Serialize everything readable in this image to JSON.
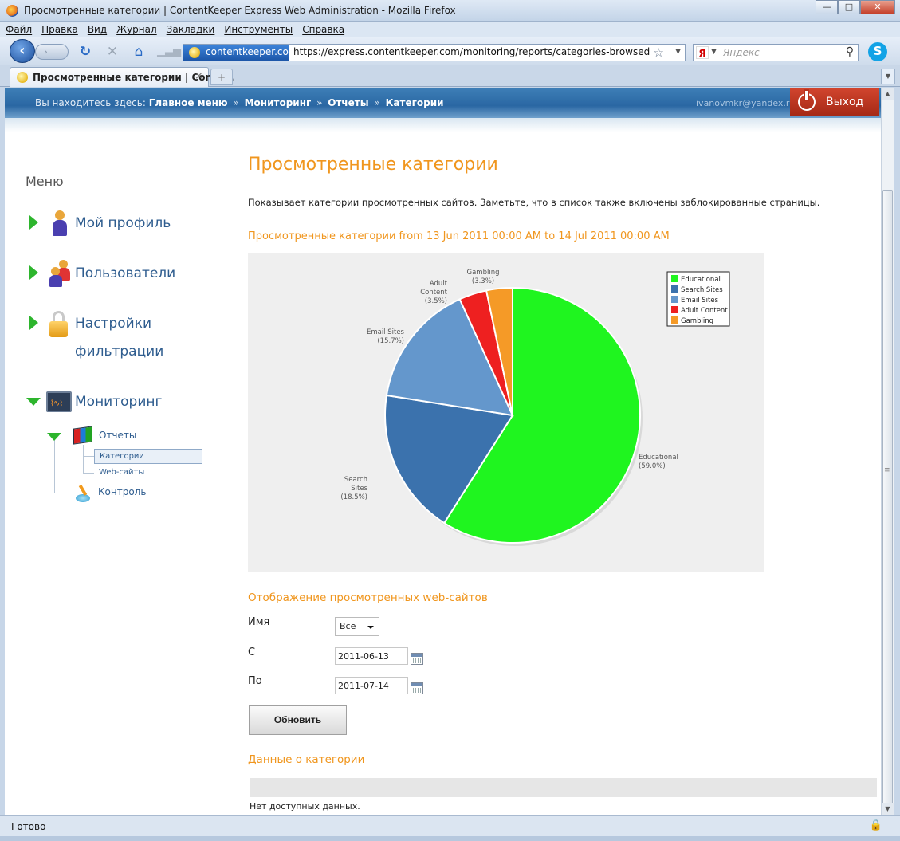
{
  "window": {
    "title": "Просмотренные категории | ContentKeeper Express Web Administration - Mozilla Firefox",
    "controls": [
      "—",
      "□",
      "✕"
    ]
  },
  "menubar": [
    "Файл",
    "Правка",
    "Вид",
    "Журнал",
    "Закладки",
    "Инструменты",
    "Справка"
  ],
  "navbar": {
    "site_identity": "contentkeeper.com",
    "url": "https://express.contentkeeper.com/monitoring/reports/categories-browsed",
    "search_placeholder": "Яндекс",
    "search_engine_badge": "Я"
  },
  "tab": {
    "title": "Просмотренные категории | Conte...",
    "close": "×",
    "new": "+"
  },
  "header": {
    "breadcrumb_prefix": "Вы находитесь здесь:",
    "breadcrumbs": [
      "Главное меню",
      "Мониторинг",
      "Отчеты",
      "Категории"
    ],
    "breadcrumb_sep": "»",
    "user_email": "ivanovmkr@yandex.ru",
    "logout": "Выход"
  },
  "sidebar": {
    "menu_title": "Меню",
    "items": [
      {
        "label": "Мой профиль"
      },
      {
        "label": "Пользователи"
      },
      {
        "label": "Настройки",
        "label2": "фильтрации"
      },
      {
        "label": "Мониторинг"
      }
    ],
    "reports": "Отчеты",
    "categories": "Категории",
    "websites": "Web-сайты",
    "control": "Контроль"
  },
  "main": {
    "title": "Просмотренные категории",
    "description": "Показывает категории просмотренных сайтов. Заметьте, что в список также включены заблокированные страницы.",
    "chart_heading": "Просмотренные категории from 13 Jun 2011 00:00 AM to 14 Jul 2011 00:00 AM",
    "display_heading": "Отображение просмотренных web-сайтов",
    "name_label": "Имя",
    "name_value": "Все",
    "from_label": "С",
    "from_value": "2011-06-13",
    "to_label": "По",
    "to_value": "2011-07-14",
    "update_button": "Обновить",
    "data_heading": "Данные о категории",
    "no_data": "Нет доступных данных."
  },
  "status": {
    "text": "Готово"
  },
  "chart_data": {
    "type": "pie",
    "categories": [
      "Educational",
      "Search Sites",
      "Email Sites",
      "Adult Content",
      "Gambling"
    ],
    "values": [
      59.0,
      18.5,
      15.7,
      3.5,
      3.3
    ],
    "value_labels": [
      "(59.0%)",
      "(18.5%)",
      "(15.7%)",
      "(3.5%)",
      "(3.3%)"
    ],
    "slice_labels": [
      [
        "Educational"
      ],
      [
        "Search",
        "Sites"
      ],
      [
        "Email Sites"
      ],
      [
        "Adult",
        "Content"
      ],
      [
        "Gambling"
      ]
    ],
    "colors": [
      "#1ff51f",
      "#3b72ad",
      "#6497cc",
      "#ee2020",
      "#f59a27"
    ],
    "legend": "top-right"
  }
}
